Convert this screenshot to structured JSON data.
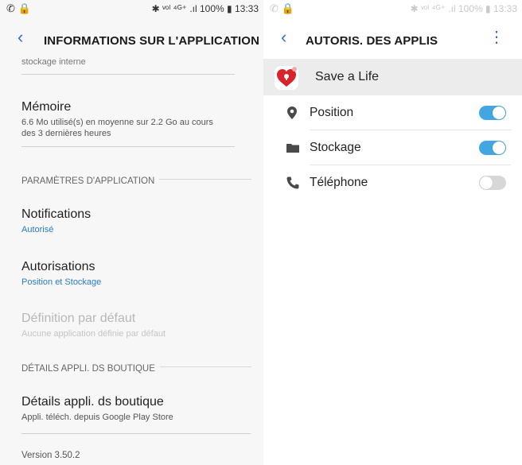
{
  "left_panel": {
    "status": {
      "left": "✆ 🔒",
      "right": "✱ ᵛᵒˡ ⁴ᴳ⁺ .ıl 100% ▮ 13:33"
    },
    "header": {
      "title": "INFORMATIONS SUR L'APPLICATION",
      "back_icon": "chevron-left-icon"
    },
    "storage_partial": "stockage interne",
    "memory": {
      "title": "Mémoire",
      "subtitle": "6.6 Mo utilisé(s) en moyenne sur 2.2 Go au cours des 3 dernières heures"
    },
    "section_app_params": "PARAMÈTRES D'APPLICATION",
    "notifications": {
      "title": "Notifications",
      "subtitle": "Autorisé"
    },
    "permissions": {
      "title": "Autorisations",
      "subtitle": "Position et Stockage"
    },
    "default_setting": {
      "title": "Définition par défaut",
      "subtitle": "Aucune application définie par défaut"
    },
    "section_store": "DÉTAILS APPLI. DS BOUTIQUE",
    "store_details": {
      "title": "Détails appli. ds boutique",
      "subtitle": "Appli. téléch. depuis Google Play Store"
    },
    "version": "Version 3.50.2"
  },
  "right_panel": {
    "status": {
      "left": "✆ 🔒",
      "right": "✱ ᵛᵒˡ ⁴ᴳ⁺ .ıl 100% ▮ 13:33"
    },
    "header": {
      "title": "AUTORIS. DES APPLIS",
      "back_icon": "chevron-left-icon",
      "menu_icon": "more-vert-icon"
    },
    "app": {
      "name": "Save a Life",
      "icon": "heart-icon"
    },
    "permissions": [
      {
        "label": "Position",
        "icon": "location-pin-icon",
        "enabled": true
      },
      {
        "label": "Stockage",
        "icon": "folder-icon",
        "enabled": true
      },
      {
        "label": "Téléphone",
        "icon": "phone-icon",
        "enabled": false
      }
    ]
  },
  "colors": {
    "accent": "#2f6fd6",
    "toggle_on": "#42a7e1",
    "toggle_off": "#d7d7d7",
    "link_blue": "#2a7bc6"
  }
}
